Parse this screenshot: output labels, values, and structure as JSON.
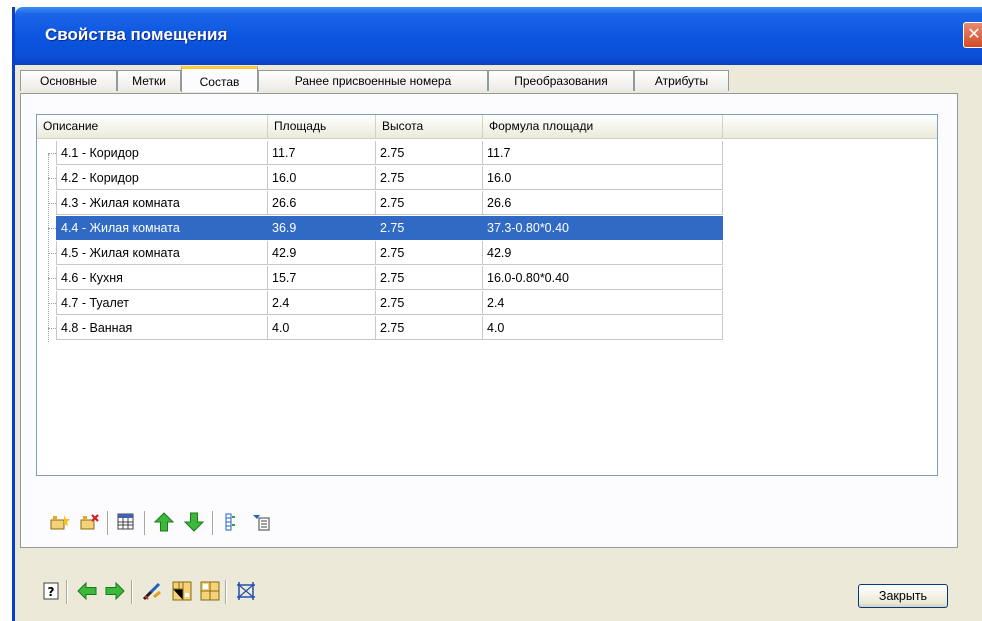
{
  "window": {
    "title": "Свойства помещения",
    "close_glyph": "✕"
  },
  "tabs": [
    {
      "label": "Основные"
    },
    {
      "label": "Метки"
    },
    {
      "label": "Состав",
      "active": true
    },
    {
      "label": "Ранее присвоенные номера"
    },
    {
      "label": "Преобразования"
    },
    {
      "label": "Атрибуты"
    }
  ],
  "table": {
    "columns": [
      "Описание",
      "Площадь",
      "Высота",
      "Формула площади"
    ],
    "rows": [
      {
        "description": "4.1 - Коридор",
        "area": "11.7",
        "height": "2.75",
        "formula": "11.7"
      },
      {
        "description": "4.2 - Коридор",
        "area": "16.0",
        "height": "2.75",
        "formula": "16.0"
      },
      {
        "description": "4.3 - Жилая комната",
        "area": "26.6",
        "height": "2.75",
        "formula": "26.6"
      },
      {
        "description": "4.4 - Жилая комната",
        "area": "36.9",
        "height": "2.75",
        "formula": "37.3-0.80*0.40",
        "selected": true
      },
      {
        "description": "4.5 - Жилая комната",
        "area": "42.9",
        "height": "2.75",
        "formula": "42.9"
      },
      {
        "description": "4.6 - Кухня",
        "area": "15.7",
        "height": "2.75",
        "formula": "16.0-0.80*0.40"
      },
      {
        "description": "4.7 - Туалет",
        "area": "2.4",
        "height": "2.75",
        "formula": "2.4"
      },
      {
        "description": "4.8 - Ванная",
        "area": "4.0",
        "height": "2.75",
        "formula": "4.0"
      }
    ]
  },
  "panel_toolbar": {
    "icons": [
      "add-room-icon",
      "delete-room-icon",
      "table-icon",
      "arrow-up-icon",
      "arrow-down-icon",
      "list-icon",
      "properties-icon"
    ]
  },
  "bottom_toolbar": {
    "icons": [
      "help-icon",
      "arrow-left-icon",
      "arrow-right-icon",
      "brush-icon",
      "plan-icon",
      "plan-alt-icon",
      "grid-icon"
    ],
    "close_label": "Закрыть"
  },
  "colors": {
    "title_bar": "#0a4fd6",
    "selection": "#316ac5",
    "active_tab_accent": "#ffc83c",
    "arrow_green": "#3cb83c"
  }
}
